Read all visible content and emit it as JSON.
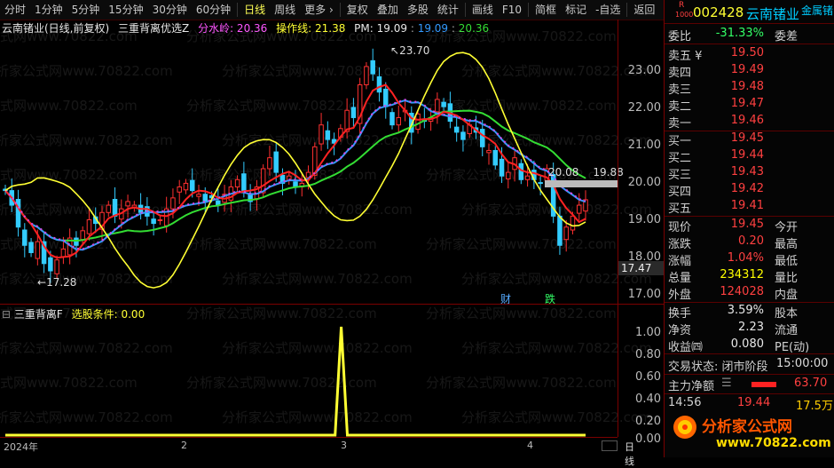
{
  "toolbar": {
    "items": [
      "分时",
      "1分钟",
      "5分钟",
      "15分钟",
      "30分钟",
      "60分钟",
      "日线",
      "周线",
      "更多 ›",
      "复权",
      "叠加",
      "多股",
      "统计",
      "画线",
      "F10",
      "简框",
      "标记",
      "-自选",
      "返回"
    ],
    "active_index": 6
  },
  "title_line": {
    "stock_period": "云南锗业(日线,前复权)",
    "indicator": "三重背离优选Z",
    "fsl_label": "分水岭: 20.36",
    "czx_label": "操作线: 21.38",
    "pm_label": "PM: 19.09",
    "v2_label": "19.09",
    "v3_label": "20.36"
  },
  "main_axis": {
    "ticks": [
      "23.00",
      "22.00",
      "21.00",
      "20.00",
      "19.00",
      "18.00",
      "17.00"
    ],
    "current_price_tag": "17.47"
  },
  "annotations": {
    "high": "23.70",
    "low": "17.28",
    "line_left": "20.08",
    "line_right": "19.88",
    "tag_cai": "财",
    "tag_die": "跌"
  },
  "sub_chart": {
    "title": "三重背离F",
    "condition": "选股条件: 0.00",
    "ticks": [
      "1.00",
      "0.80",
      "0.60",
      "0.40",
      "0.20",
      "0.00"
    ],
    "series_values": [
      0,
      0,
      0,
      0,
      0,
      0,
      0,
      0,
      0,
      0,
      0,
      0,
      0,
      0,
      0,
      0,
      0,
      0,
      0,
      0,
      0,
      0,
      0,
      0,
      0,
      0,
      0,
      0,
      0,
      0,
      0,
      0,
      0,
      0,
      0,
      0,
      0,
      0,
      0,
      0,
      0,
      0,
      0,
      0,
      0,
      0,
      0,
      0,
      0,
      0,
      0,
      0,
      0,
      0,
      0,
      1,
      0,
      0,
      0,
      0,
      0,
      0,
      0,
      0,
      0,
      0,
      0,
      0,
      0,
      0,
      0,
      0,
      0,
      0,
      0,
      0,
      0,
      0,
      0,
      0,
      0,
      0,
      0,
      0,
      0,
      0,
      0,
      0,
      0,
      0,
      0,
      0,
      0,
      0,
      0,
      0
    ]
  },
  "dates": {
    "labels": [
      "2024年",
      "2",
      "3",
      "4"
    ],
    "right_label": "日线"
  },
  "panel": {
    "r_badge": "R",
    "code_badge": "1000",
    "code": "002428",
    "name": "云南锗业",
    "sector": "金属锗",
    "weibi_label": "委比",
    "weibi_value": "-31.33%",
    "weicha_label": "委差",
    "asks": [
      {
        "label": "卖五 ¥",
        "price": "19.50"
      },
      {
        "label": "卖四",
        "price": "19.49"
      },
      {
        "label": "卖三",
        "price": "19.48"
      },
      {
        "label": "卖二",
        "price": "19.47"
      },
      {
        "label": "卖一",
        "price": "19.46"
      }
    ],
    "bids": [
      {
        "label": "买一",
        "price": "19.45"
      },
      {
        "label": "买二",
        "price": "19.44"
      },
      {
        "label": "买三",
        "price": "19.43"
      },
      {
        "label": "买四",
        "price": "19.42"
      },
      {
        "label": "买五",
        "price": "19.41"
      }
    ],
    "stats": [
      {
        "label": "现价",
        "value": "19.45",
        "label2": "今开",
        "color": "red"
      },
      {
        "label": "涨跌",
        "value": "0.20",
        "label2": "最高",
        "color": "red"
      },
      {
        "label": "涨幅",
        "value": "1.04%",
        "label2": "最低",
        "color": "red"
      },
      {
        "label": "总量",
        "value": "234312",
        "label2": "量比",
        "color": "yellow"
      },
      {
        "label": "外盘",
        "value": "124028",
        "label2": "内盘",
        "color": "red"
      }
    ],
    "stats2": [
      {
        "label": "换手",
        "value": "3.59%",
        "label2": "股本"
      },
      {
        "label": "净资",
        "value": "2.23",
        "label2": "流通"
      },
      {
        "label": "收益㈣",
        "value": "0.080",
        "label2": "PE(动)"
      }
    ],
    "status_label": "交易状态: 闭市阶段",
    "status_time": "15:00:00",
    "main_net_label": "主力净额",
    "main_net_value": "63.70",
    "tick_time": "14:56",
    "tick_price": "19.44",
    "tick_vol": "17.5万",
    "brand": "分析家公式网",
    "brand_url": "www.70822.com"
  },
  "watermark": {
    "text": "分析家公式网www.70822.com"
  },
  "colors": {
    "up": "#ff3030",
    "down": "#33ccff",
    "yellow_line": "#ffff33",
    "green_line": "#33dd33",
    "blue_line": "#3399ff",
    "red_line": "#ff2222",
    "magenta": "#dd44dd"
  }
}
